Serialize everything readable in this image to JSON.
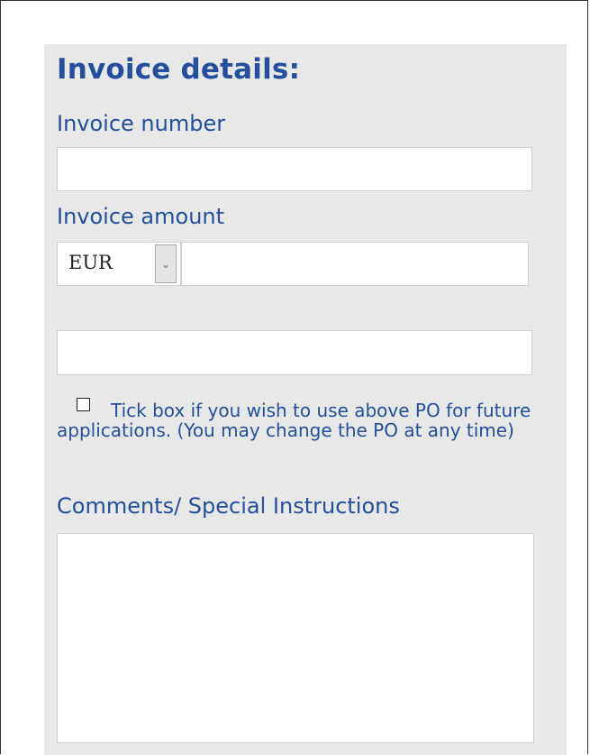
{
  "form": {
    "title": "Invoice details:",
    "invoice_number": {
      "label": "Invoice number",
      "value": ""
    },
    "invoice_amount": {
      "label": "Invoice amount",
      "currency": "EUR",
      "currency_icon": "chevron-down-icon",
      "value": ""
    },
    "po_number": {
      "value": ""
    },
    "po_reuse": {
      "checked": false,
      "text": "Tick box if you wish to use above PO for future applications. (You may change the PO at any time)"
    },
    "comments": {
      "label": "Comments/ Special Instructions",
      "value": ""
    }
  },
  "colors": {
    "panel_bg": "#e8e8e8",
    "label_text": "#234f9c",
    "field_bg": "#ffffff"
  }
}
